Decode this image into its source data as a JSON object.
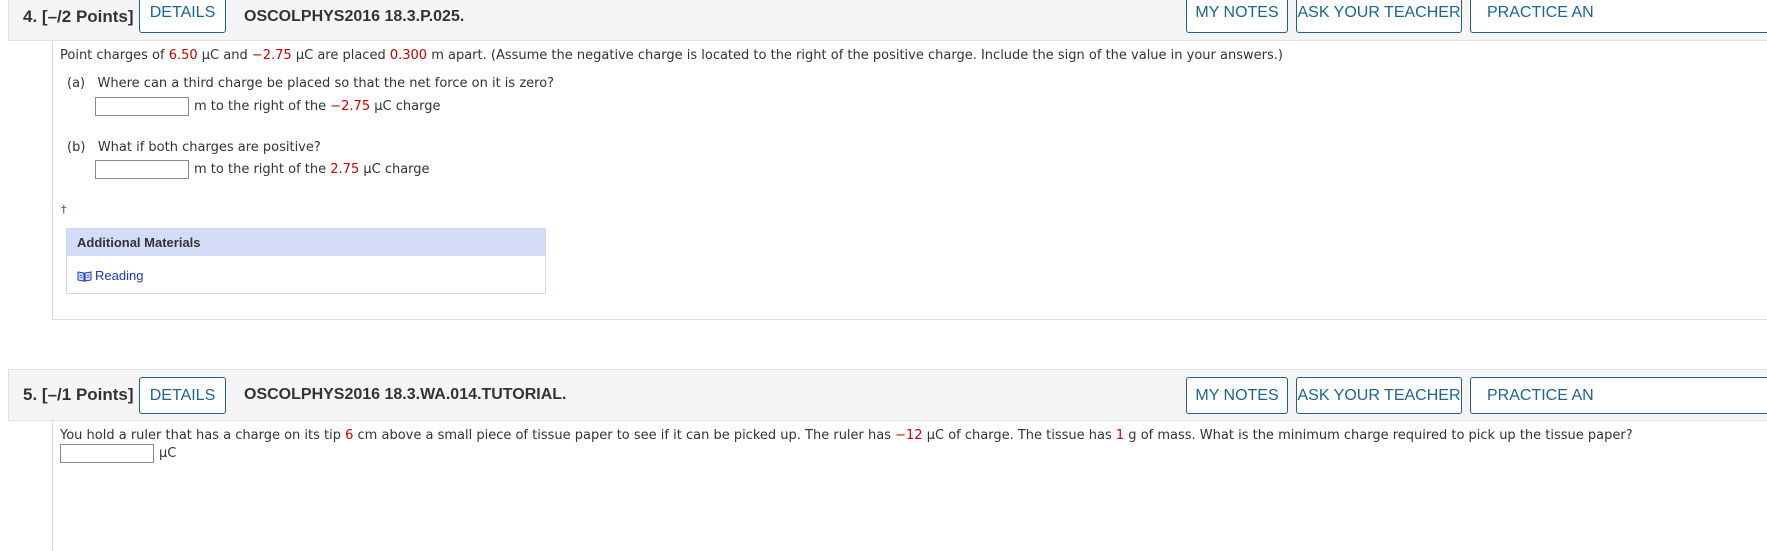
{
  "q4": {
    "number": "4.",
    "points": "[–/2 Points]",
    "details_label": "DETAILS",
    "code": "OSCOLPHYS2016 18.3.P.025.",
    "my_notes_label": "MY NOTES",
    "ask_teacher_label": "ASK YOUR TEACHER",
    "practice_label": "PRACTICE AN",
    "intro": {
      "t1": "Point charges of ",
      "v1": "6.50",
      "t2": " μC and ",
      "v2": "−2.75",
      "t3": " μC are placed ",
      "v3": "0.300",
      "t4": " m apart. (Assume the negative charge is located to the right of the positive charge. Include the sign of the value in your answers.)"
    },
    "part_a": {
      "label": "(a)",
      "question": "Where can a third charge be placed so that the net force on it is zero?",
      "answer_value": "",
      "suffix_1": "m to the right of the ",
      "suffix_value": "−2.75",
      "suffix_2": " μC charge"
    },
    "part_b": {
      "label": "(b)",
      "question": "What if both charges are positive?",
      "answer_value": "",
      "suffix_1": "m to the right of the ",
      "suffix_value": "2.75",
      "suffix_2": " μC charge"
    },
    "dagger": "†",
    "additional_materials": {
      "title": "Additional Materials",
      "link": "Reading",
      "icon": "book-icon"
    }
  },
  "q5": {
    "number": "5.",
    "points": "[–/1 Points]",
    "details_label": "DETAILS",
    "code": "OSCOLPHYS2016 18.3.WA.014.TUTORIAL.",
    "my_notes_label": "MY NOTES",
    "ask_teacher_label": "ASK YOUR TEACHER",
    "practice_label": "PRACTICE AN",
    "question": {
      "t1": "You hold a ruler that has a charge on its tip ",
      "v1": "6",
      "t2": " cm above a small piece of tissue paper to see if it can be picked up. The ruler has ",
      "v2": "−12",
      "t3": " μC of charge. The tissue has ",
      "v3": "1",
      "t4": " g of mass. What is the minimum charge required to pick up the tissue paper?"
    },
    "answer_value": "",
    "unit": "μC"
  },
  "colors": {
    "accent": "#1a6496",
    "given_value": "#cc0000",
    "header_bg": "#f5f5f5",
    "materials_header": "#d5dcf7"
  }
}
